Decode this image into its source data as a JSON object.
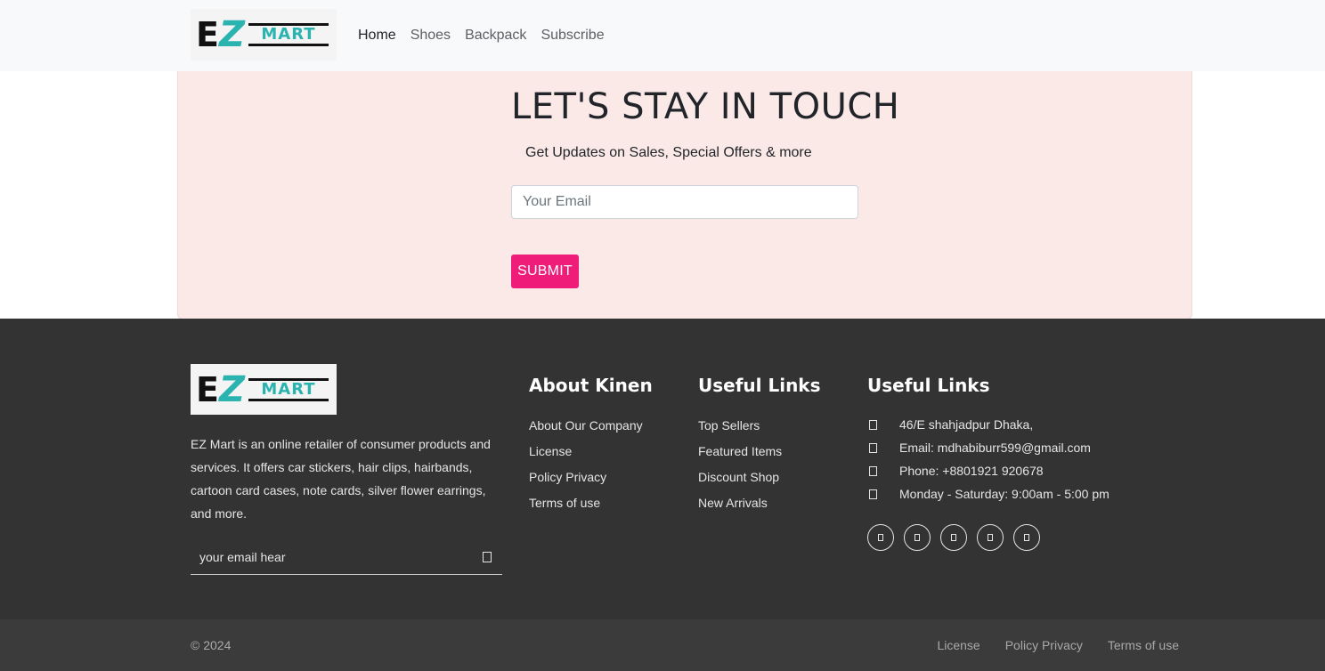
{
  "brand": {
    "letter_e": "E",
    "letter_z": "Z",
    "mart": "MART",
    "teal": "#2bb3b0"
  },
  "nav": {
    "links": [
      {
        "label": "Home",
        "active": true
      },
      {
        "label": "Shoes",
        "active": false
      },
      {
        "label": "Backpack",
        "active": false
      },
      {
        "label": "Subscribe",
        "active": false
      }
    ]
  },
  "subscribe": {
    "title": "LET'S STAY IN TOUCH",
    "subtitle": "Get Updates on Sales, Special Offers & more",
    "email_placeholder": "Your Email",
    "submit_label": "SUBMIT",
    "bg_color": "#fbe9e8",
    "button_color": "#f01c7a"
  },
  "footer": {
    "description": "EZ Mart is an online retailer of consumer products and services. It offers car stickers, hair clips, hairbands, cartoon card cases, note cards, silver flower earrings, and more.",
    "newsletter_placeholder": "your email hear",
    "about": {
      "heading": "About Kinen",
      "links": [
        "About Our Company",
        "License",
        "Policy Privacy",
        "Terms of use"
      ]
    },
    "useful": {
      "heading": "Useful Links",
      "links": [
        "Top Sellers",
        "Featured Items",
        "Discount Shop",
        "New Arrivals"
      ]
    },
    "contact": {
      "heading": "Useful Links",
      "items": [
        {
          "icon": "location-icon",
          "text": "46/E shahjadpur Dhaka,"
        },
        {
          "icon": "email-icon",
          "text": "Email: mdhabiburr599@gmail.com"
        },
        {
          "icon": "phone-icon",
          "text": "Phone: +8801921 920678"
        },
        {
          "icon": "clock-icon",
          "text": "Monday - Saturday: 9:00am - 5:00 pm"
        }
      ]
    },
    "socials": [
      "facebook-icon",
      "twitter-icon",
      "instagram-icon",
      "linkedin-icon",
      "youtube-icon"
    ],
    "bg_color": "#333333"
  },
  "bottom": {
    "copyright": "© 2024",
    "links": [
      "License",
      "Policy Privacy",
      "Terms of use"
    ]
  }
}
